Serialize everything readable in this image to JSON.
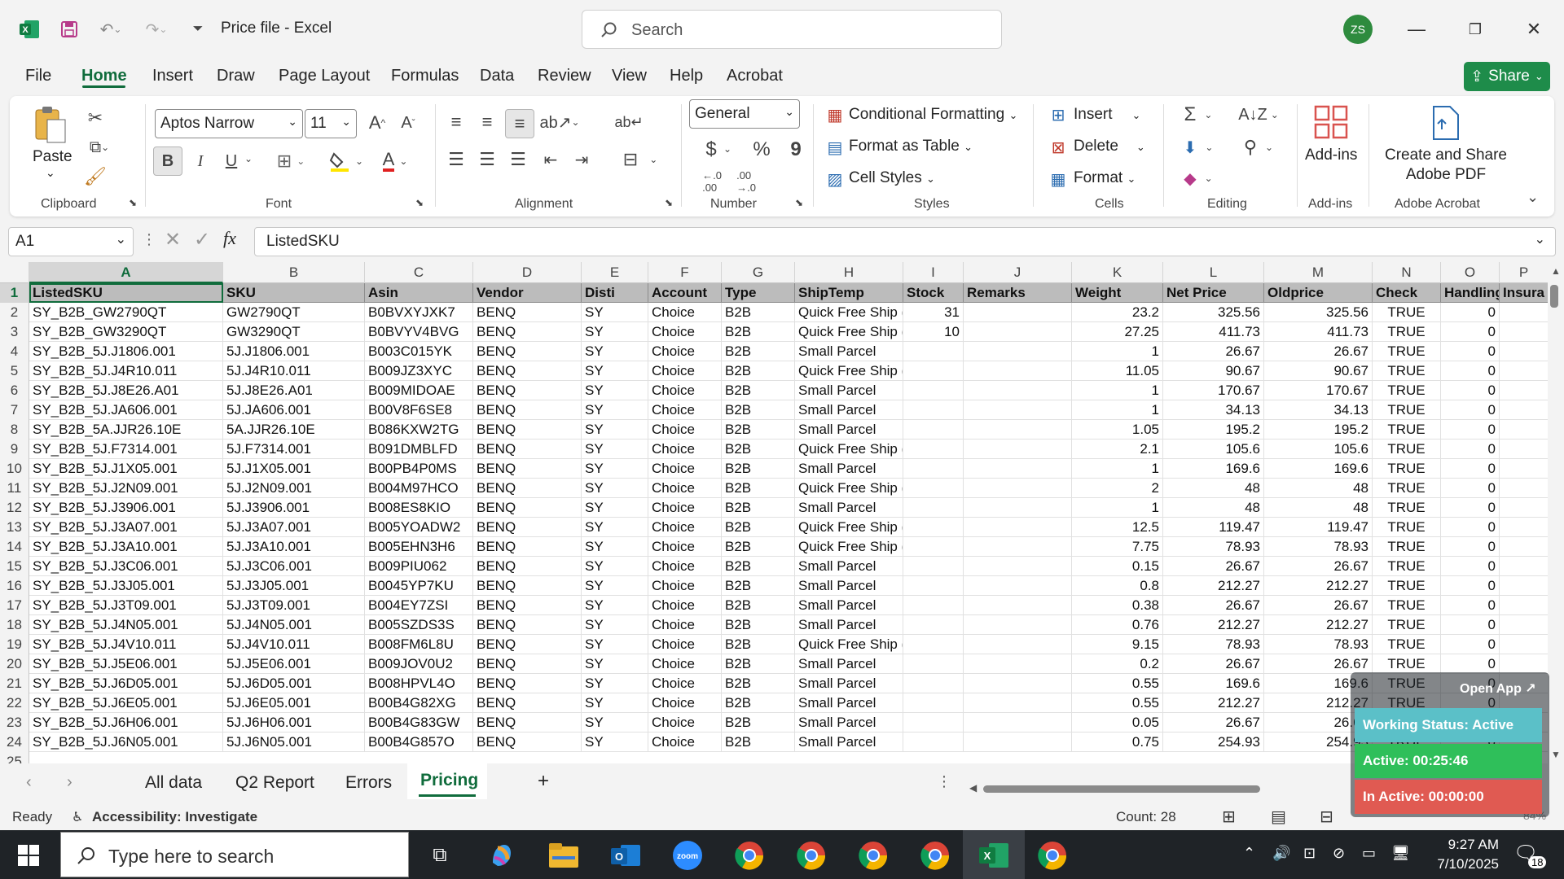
{
  "window": {
    "title": "Price file  -  Excel",
    "search_placeholder": "Search",
    "user_initials": "ZS"
  },
  "menu": {
    "items": [
      "File",
      "Home",
      "Insert",
      "Draw",
      "Page Layout",
      "Formulas",
      "Data",
      "Review",
      "View",
      "Help",
      "Acrobat"
    ],
    "share": "Share"
  },
  "ribbon": {
    "clipboard": {
      "paste": "Paste",
      "label": "Clipboard"
    },
    "font": {
      "name": "Aptos Narrow",
      "size": "11",
      "bold": "B",
      "italic": "I",
      "underline": "U",
      "label": "Font"
    },
    "alignment": {
      "label": "Alignment"
    },
    "number": {
      "format": "General",
      "currency": "$",
      "percent": "%",
      "comma": "9",
      "label": "Number"
    },
    "styles": {
      "conditional": "Conditional Formatting",
      "table": "Format as Table",
      "cell_styles": "Cell Styles",
      "label": "Styles"
    },
    "cells": {
      "insert": "Insert",
      "delete": "Delete",
      "format": "Format",
      "label": "Cells"
    },
    "editing": {
      "label": "Editing"
    },
    "addins": {
      "btn": "Add-ins",
      "label": "Add-ins"
    },
    "acrobat": {
      "btn1": "Create and Share",
      "btn2": "Adobe PDF",
      "label": "Adobe Acrobat"
    }
  },
  "formula_bar": {
    "cell_ref": "A1",
    "content": "ListedSKU",
    "fx": "fx"
  },
  "grid": {
    "columns": [
      "A",
      "B",
      "C",
      "D",
      "E",
      "F",
      "G",
      "H",
      "I",
      "J",
      "K",
      "L",
      "M",
      "N",
      "O",
      "P"
    ],
    "headers": [
      "ListedSKU",
      "SKU",
      "Asin",
      "Vendor",
      "Disti",
      "Account",
      "Type",
      "ShipTemp",
      "Stock",
      "Remarks",
      "Weight",
      "Net Price",
      "Oldprice",
      "Check",
      "Handling",
      "Insura"
    ],
    "rows": [
      [
        "2",
        "SY_B2B_GW2790QT",
        "GW2790QT",
        "B0BVXYJXK7",
        "BENQ",
        "SY",
        "Choice",
        "B2B",
        "Quick Free Ship (",
        "31",
        "",
        "23.2",
        "325.56",
        "325.56",
        "TRUE",
        "0"
      ],
      [
        "3",
        "SY_B2B_GW3290QT",
        "GW3290QT",
        "B0BVYV4BVG",
        "BENQ",
        "SY",
        "Choice",
        "B2B",
        "Quick Free Ship (",
        "10",
        "",
        "27.25",
        "411.73",
        "411.73",
        "TRUE",
        "0"
      ],
      [
        "4",
        "SY_B2B_5J.J1806.001",
        "5J.J1806.001",
        "B003C015YK",
        "BENQ",
        "SY",
        "Choice",
        "B2B",
        "Small Parcel",
        "",
        "",
        "1",
        "26.67",
        "26.67",
        "TRUE",
        "0"
      ],
      [
        "5",
        "SY_B2B_5J.J4R10.011",
        "5J.J4R10.011",
        "B009JZ3XYC",
        "BENQ",
        "SY",
        "Choice",
        "B2B",
        "Quick Free Ship (",
        "",
        "",
        "11.05",
        "90.67",
        "90.67",
        "TRUE",
        "0"
      ],
      [
        "6",
        "SY_B2B_5J.J8E26.A01",
        "5J.J8E26.A01",
        "B009MIDOAE",
        "BENQ",
        "SY",
        "Choice",
        "B2B",
        "Small Parcel",
        "",
        "",
        "1",
        "170.67",
        "170.67",
        "TRUE",
        "0"
      ],
      [
        "7",
        "SY_B2B_5J.JA606.001",
        "5J.JA606.001",
        "B00V8F6SE8",
        "BENQ",
        "SY",
        "Choice",
        "B2B",
        "Small Parcel",
        "",
        "",
        "1",
        "34.13",
        "34.13",
        "TRUE",
        "0"
      ],
      [
        "8",
        "SY_B2B_5A.JJR26.10E",
        "5A.JJR26.10E",
        "B086KXW2TG",
        "BENQ",
        "SY",
        "Choice",
        "B2B",
        "Small Parcel",
        "",
        "",
        "1.05",
        "195.2",
        "195.2",
        "TRUE",
        "0"
      ],
      [
        "9",
        "SY_B2B_5J.F7314.001",
        "5J.F7314.001",
        "B091DMBLFD",
        "BENQ",
        "SY",
        "Choice",
        "B2B",
        "Quick Free Ship (",
        "",
        "",
        "2.1",
        "105.6",
        "105.6",
        "TRUE",
        "0"
      ],
      [
        "10",
        "SY_B2B_5J.J1X05.001",
        "5J.J1X05.001",
        "B00PB4P0MS",
        "BENQ",
        "SY",
        "Choice",
        "B2B",
        "Small Parcel",
        "",
        "",
        "1",
        "169.6",
        "169.6",
        "TRUE",
        "0"
      ],
      [
        "11",
        "SY_B2B_5J.J2N09.001",
        "5J.J2N09.001",
        "B004M97HCO",
        "BENQ",
        "SY",
        "Choice",
        "B2B",
        "Quick Free Ship (",
        "",
        "",
        "2",
        "48",
        "48",
        "TRUE",
        "0"
      ],
      [
        "12",
        "SY_B2B_5J.J3906.001",
        "5J.J3906.001",
        "B008ES8KIO",
        "BENQ",
        "SY",
        "Choice",
        "B2B",
        "Small Parcel",
        "",
        "",
        "1",
        "48",
        "48",
        "TRUE",
        "0"
      ],
      [
        "13",
        "SY_B2B_5J.J3A07.001",
        "5J.J3A07.001",
        "B005YOADW2",
        "BENQ",
        "SY",
        "Choice",
        "B2B",
        "Quick Free Ship (",
        "",
        "",
        "12.5",
        "119.47",
        "119.47",
        "TRUE",
        "0"
      ],
      [
        "14",
        "SY_B2B_5J.J3A10.001",
        "5J.J3A10.001",
        "B005EHN3H6",
        "BENQ",
        "SY",
        "Choice",
        "B2B",
        "Quick Free Ship (",
        "",
        "",
        "7.75",
        "78.93",
        "78.93",
        "TRUE",
        "0"
      ],
      [
        "15",
        "SY_B2B_5J.J3C06.001",
        "5J.J3C06.001",
        "B009PIU062",
        "BENQ",
        "SY",
        "Choice",
        "B2B",
        "Small Parcel",
        "",
        "",
        "0.15",
        "26.67",
        "26.67",
        "TRUE",
        "0"
      ],
      [
        "16",
        "SY_B2B_5J.J3J05.001",
        "5J.J3J05.001",
        "B0045YP7KU",
        "BENQ",
        "SY",
        "Choice",
        "B2B",
        "Small Parcel",
        "",
        "",
        "0.8",
        "212.27",
        "212.27",
        "TRUE",
        "0"
      ],
      [
        "17",
        "SY_B2B_5J.J3T09.001",
        "5J.J3T09.001",
        "B004EY7ZSI",
        "BENQ",
        "SY",
        "Choice",
        "B2B",
        "Small Parcel",
        "",
        "",
        "0.38",
        "26.67",
        "26.67",
        "TRUE",
        "0"
      ],
      [
        "18",
        "SY_B2B_5J.J4N05.001",
        "5J.J4N05.001",
        "B005SZDS3S",
        "BENQ",
        "SY",
        "Choice",
        "B2B",
        "Small Parcel",
        "",
        "",
        "0.76",
        "212.27",
        "212.27",
        "TRUE",
        "0"
      ],
      [
        "19",
        "SY_B2B_5J.J4V10.011",
        "5J.J4V10.011",
        "B008FM6L8U",
        "BENQ",
        "SY",
        "Choice",
        "B2B",
        "Quick Free Ship (",
        "",
        "",
        "9.15",
        "78.93",
        "78.93",
        "TRUE",
        "0"
      ],
      [
        "20",
        "SY_B2B_5J.J5E06.001",
        "5J.J5E06.001",
        "B009JOV0U2",
        "BENQ",
        "SY",
        "Choice",
        "B2B",
        "Small Parcel",
        "",
        "",
        "0.2",
        "26.67",
        "26.67",
        "TRUE",
        "0"
      ],
      [
        "21",
        "SY_B2B_5J.J6D05.001",
        "5J.J6D05.001",
        "B008HPVL4O",
        "BENQ",
        "SY",
        "Choice",
        "B2B",
        "Small Parcel",
        "",
        "",
        "0.55",
        "169.6",
        "169.6",
        "TRUE",
        "0"
      ],
      [
        "22",
        "SY_B2B_5J.J6E05.001",
        "5J.J6E05.001",
        "B00B4G82XG",
        "BENQ",
        "SY",
        "Choice",
        "B2B",
        "Small Parcel",
        "",
        "",
        "0.55",
        "212.27",
        "212.27",
        "TRUE",
        "0"
      ],
      [
        "23",
        "SY_B2B_5J.J6H06.001",
        "5J.J6H06.001",
        "B00B4G83GW",
        "BENQ",
        "SY",
        "Choice",
        "B2B",
        "Small Parcel",
        "",
        "",
        "0.05",
        "26.67",
        "26.67",
        "TRUE",
        "0"
      ],
      [
        "24",
        "SY_B2B_5J.J6N05.001",
        "5J.J6N05.001",
        "B00B4G857O",
        "BENQ",
        "SY",
        "Choice",
        "B2B",
        "Small Parcel",
        "",
        "",
        "0.75",
        "254.93",
        "254.93",
        "TRUE",
        "0"
      ]
    ]
  },
  "sheets": {
    "tabs": [
      "All data",
      "Q2 Report",
      "Errors",
      "Pricing"
    ],
    "active": "Pricing",
    "add": "+"
  },
  "status": {
    "ready": "Ready",
    "accessibility": "Accessibility: Investigate",
    "count": "Count: 28",
    "zoom": "84%"
  },
  "widget": {
    "open_app": "Open App ↗",
    "working": "Working Status: Active",
    "active": "Active: 00:25:46",
    "inactive": "In Active: 00:00:00",
    "colors": {
      "working": "#5bc0c8",
      "active": "#2fbf5a",
      "inactive": "#e05a52"
    }
  },
  "taskbar": {
    "search_placeholder": "Type here to search",
    "time": "9:27 AM",
    "date": "7/10/2025",
    "notifications": "18"
  }
}
